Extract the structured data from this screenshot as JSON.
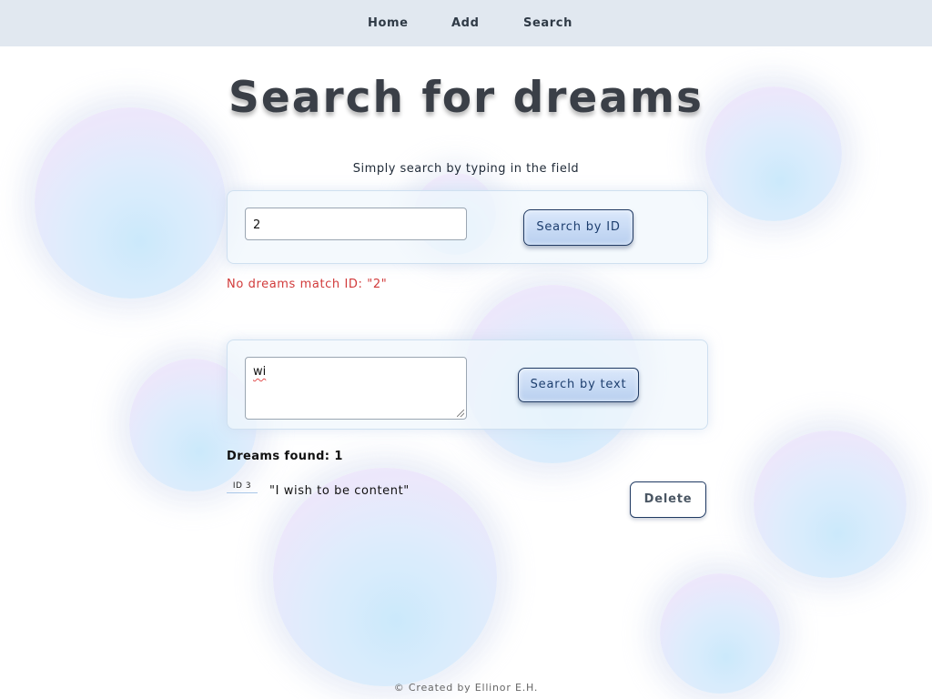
{
  "nav": {
    "items": [
      {
        "label": "Home"
      },
      {
        "label": "Add"
      },
      {
        "label": "Search"
      }
    ]
  },
  "page": {
    "title": "Search for dreams",
    "instruction": "Simply search by typing in the field"
  },
  "id_search": {
    "value": "2",
    "button_label": "Search by ID",
    "error": "No dreams match ID: \"2\""
  },
  "text_search": {
    "value": "wi",
    "button_label": "Search by text"
  },
  "results": {
    "count_label": "Dreams found: 1",
    "items": [
      {
        "id_label": "ID 3",
        "text": "\"I wish to be content\"",
        "delete_label": "Delete"
      }
    ]
  },
  "footer": {
    "text": "© Created by Ellinor E.H."
  },
  "colors": {
    "navbar_bg": "#e1e8f0",
    "error": "#d13a3a",
    "button_border": "#213b63"
  }
}
